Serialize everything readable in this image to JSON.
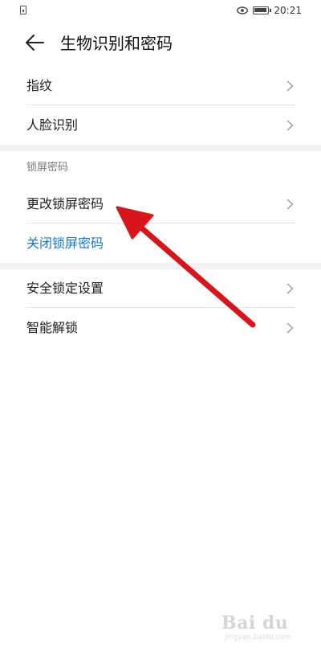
{
  "status_bar": {
    "time": "20:21",
    "icons": [
      "sim-card-icon",
      "eye-icon",
      "battery-icon"
    ]
  },
  "header": {
    "title": "生物识别和密码",
    "back_icon": "back-arrow-icon"
  },
  "section1": {
    "items": [
      {
        "label": "指纹"
      },
      {
        "label": "人脸识别"
      }
    ]
  },
  "section2": {
    "header": "锁屏密码",
    "items": [
      {
        "label": "更改锁屏密码"
      },
      {
        "label": "关闭锁屏密码"
      }
    ]
  },
  "section3": {
    "items": [
      {
        "label": "安全锁定设置"
      },
      {
        "label": "智能解锁"
      }
    ]
  },
  "colors": {
    "accent_blue": "#1479cc",
    "annotation_red": "#d9151b",
    "section_gap": "#f2f2f2"
  },
  "watermark": {
    "brand": "Bai du",
    "sub": "jingyan.baidu.com"
  }
}
